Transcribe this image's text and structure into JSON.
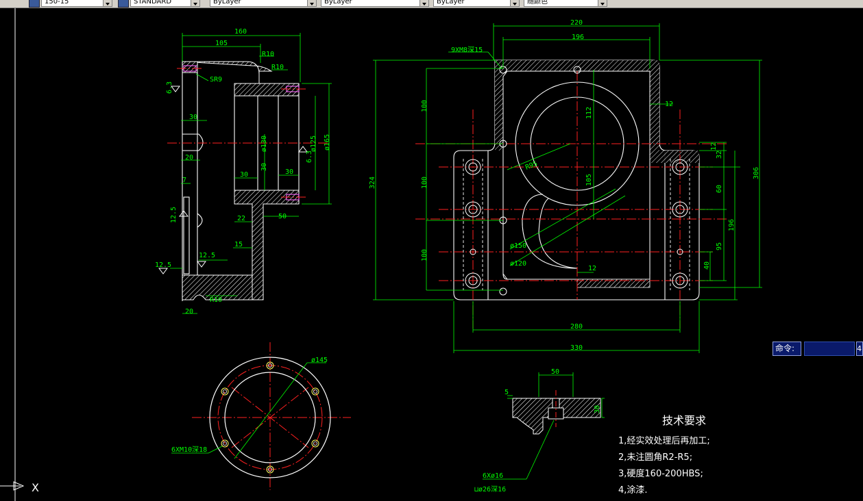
{
  "toolbar": {
    "combos": [
      "150-15",
      "STANDARD",
      "ByLayer",
      "ByLayer",
      "ByLayer",
      "随颜色"
    ]
  },
  "dims": {
    "side": {
      "d160": "160",
      "d105": "105",
      "r10a": "R10",
      "r10b": "R10",
      "sr9": "SR9",
      "d6_3a": "6.3",
      "d30a": "30",
      "d20a": "20",
      "d7": "7",
      "d12_5a": "12.5",
      "d12_5b": "12.5",
      "d12_5c": "12.5",
      "d130": "ø130",
      "d30b": "30",
      "d125": "ø125",
      "d165": "ø165",
      "d6_3b": "6.3",
      "d30c": "30",
      "d30d": "30",
      "d22": "22",
      "d50": "50",
      "d15": "15",
      "r10c": "R10",
      "d20b": "20"
    },
    "plan": {
      "d220": "220",
      "d196": "196",
      "hole_note": "9XM8深15",
      "d100a": "100",
      "d112": "112",
      "d12a": "12",
      "d324": "324",
      "d100b": "100",
      "r95": "R95",
      "d105": "105",
      "d100c": "100",
      "d150": "ø150",
      "d120": "ø120",
      "d12b": "12",
      "d12c": "12",
      "d32": "32",
      "d60": "60",
      "d196v": "196",
      "d95": "95",
      "d40": "40",
      "d306": "306",
      "d280": "280",
      "d330": "330"
    },
    "flange": {
      "d145": "ø145",
      "note": "6XM10深18"
    },
    "detail": {
      "d50": "50",
      "d5": "5",
      "d30": "30",
      "note1": "6Xø16",
      "note2": "⊔ø26深16"
    }
  },
  "tech": {
    "title": "技术要求",
    "items": [
      "1,经实效处理后再加工;",
      "2,未注圆角R2-R5;",
      "3,硬度160-200HBS;",
      "4,涂漆."
    ]
  },
  "ucs": {
    "axis_label": "X"
  },
  "command": {
    "label": "命令:",
    "value": "",
    "right": "4"
  },
  "colors": {
    "background": "#000000",
    "geometry": "#ffffff",
    "dimension": "#00ff00",
    "center": "#ff0000",
    "hatch": "#ffffff"
  }
}
